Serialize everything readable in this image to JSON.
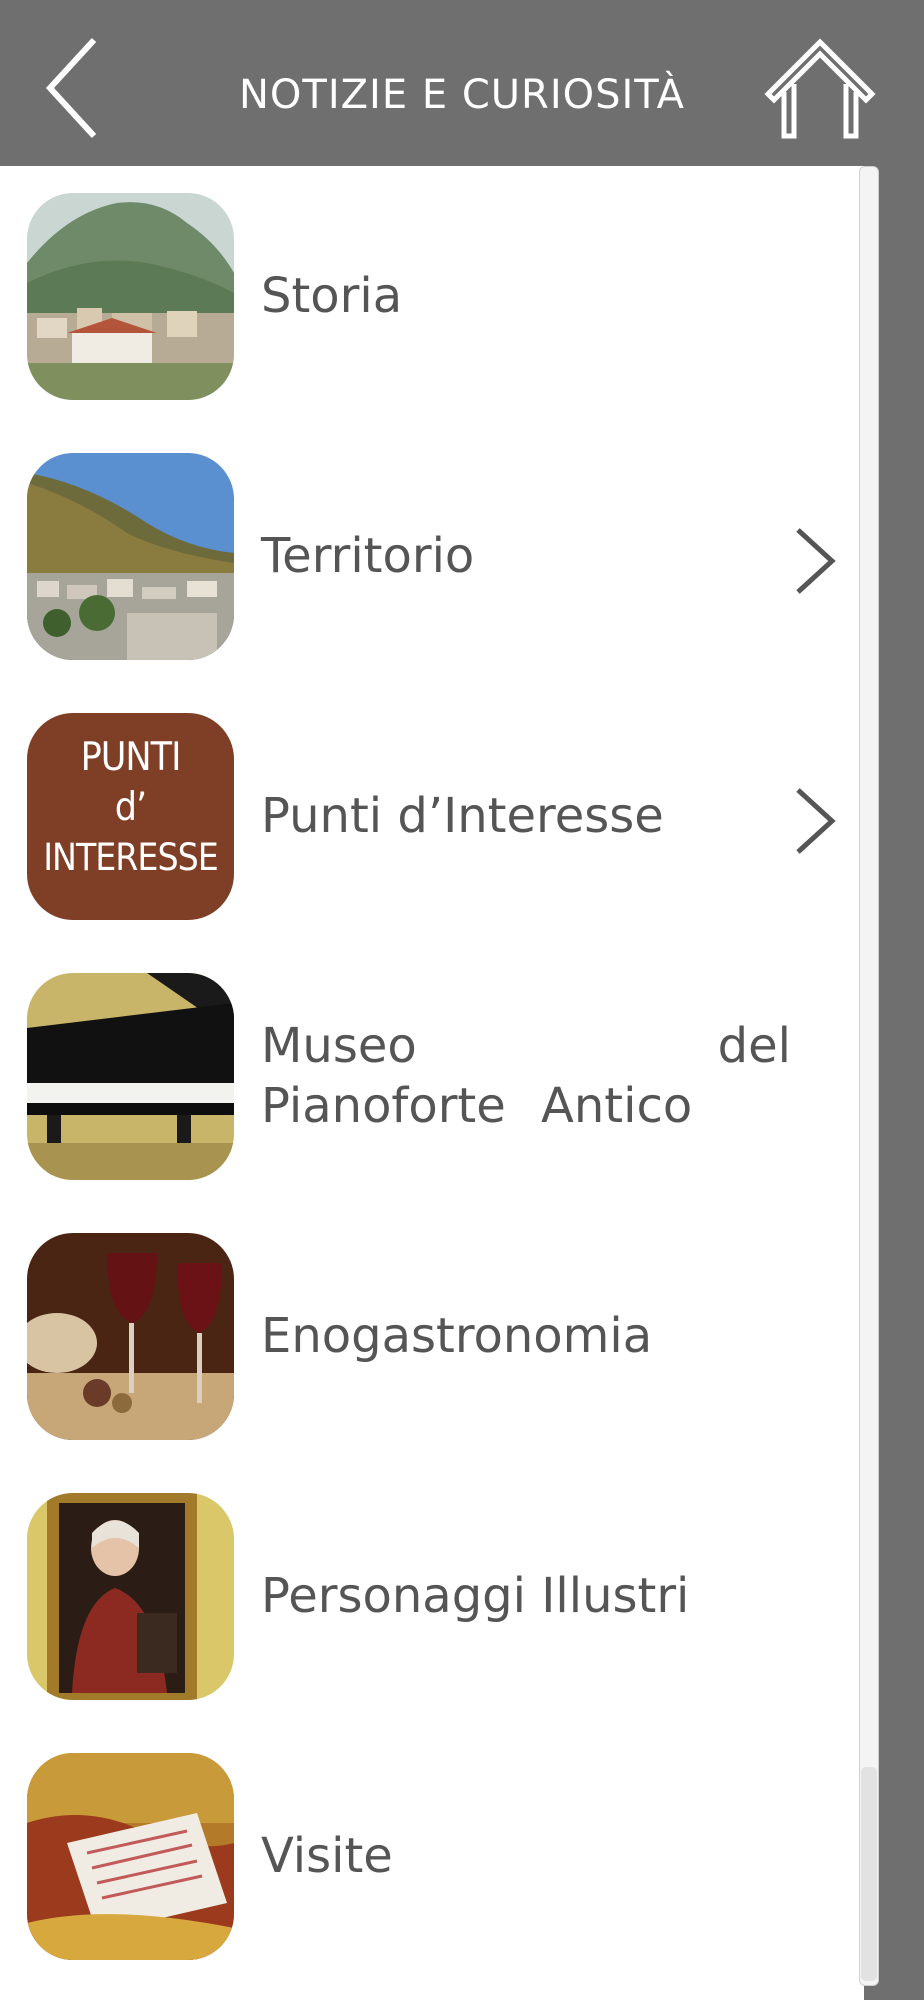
{
  "header": {
    "title": "NOTIZIE E CURIOSITÀ",
    "back_icon": "chevron-left-icon",
    "home_icon": "home-icon",
    "background": "#6f6f6f"
  },
  "menu": {
    "items": [
      {
        "label": "Storia",
        "has_chevron": false
      },
      {
        "label": "Territorio",
        "has_chevron": true
      },
      {
        "label": "Punti d’Interesse",
        "has_chevron": true,
        "thumb_text": [
          "PUNTI",
          "d’",
          "INTERESSE"
        ]
      },
      {
        "label": "Museo del Pianoforte Antico",
        "has_chevron": false
      },
      {
        "label": "Enogastronomia",
        "has_chevron": false
      },
      {
        "label": "Personaggi Illustri",
        "has_chevron": false
      },
      {
        "label": "Visite",
        "has_chevron": false
      }
    ]
  },
  "colors": {
    "label_text": "#555555",
    "punti_tile": "#7f3f26"
  }
}
